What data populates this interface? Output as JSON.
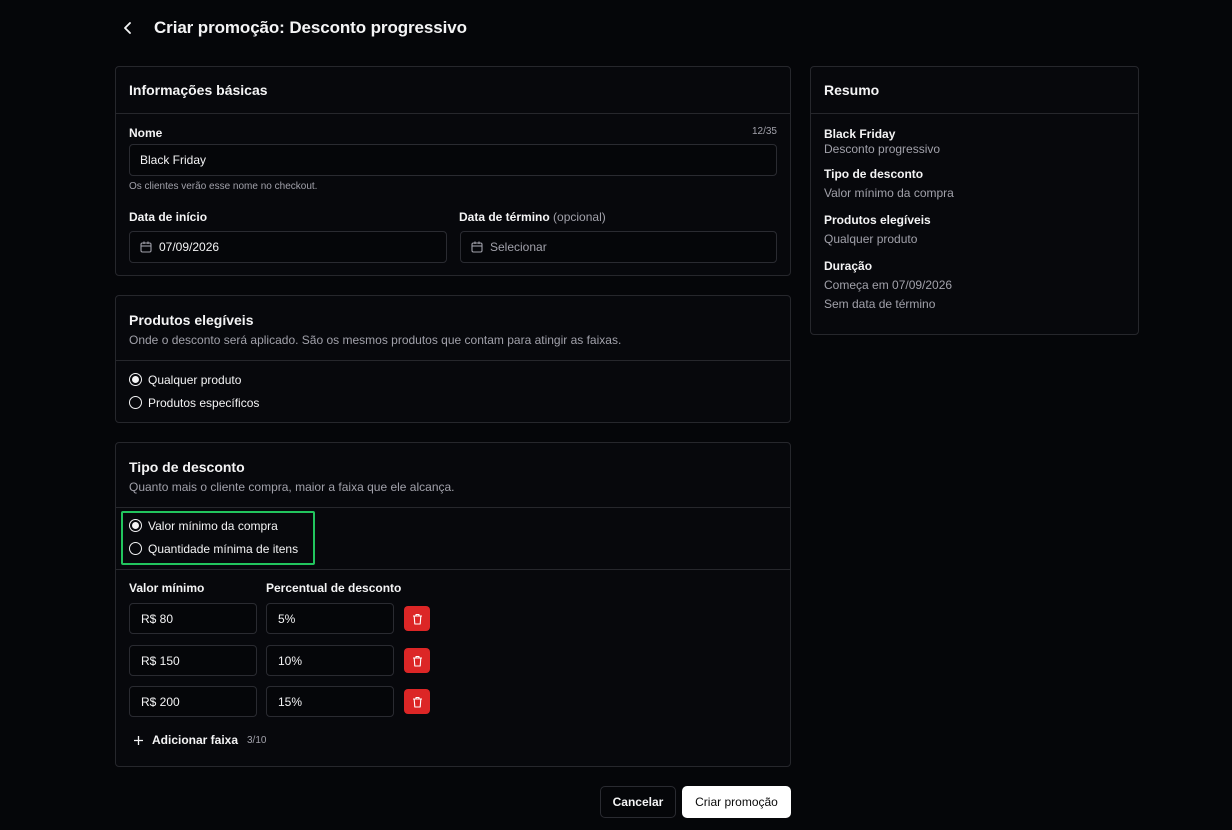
{
  "header": {
    "title": "Criar promoção: Desconto progressivo"
  },
  "basic_info": {
    "title": "Informações básicas",
    "name_label": "Nome",
    "name_count": "12/35",
    "name_value": "Black Friday",
    "name_help": "Os clientes verão esse nome no checkout.",
    "start_label": "Data de início",
    "start_value": "07/09/2026",
    "end_label": "Data de término",
    "end_optional": "(opcional)",
    "end_placeholder": "Selecionar"
  },
  "products": {
    "title": "Produtos elegíveis",
    "description": "Onde o desconto será aplicado. São os mesmos produtos que contam para atingir as faixas.",
    "options": [
      "Qualquer produto",
      "Produtos específicos"
    ],
    "selected": 0
  },
  "discount_type": {
    "title": "Tipo de desconto",
    "description": "Quanto mais o cliente compra, maior a faixa que ele alcança.",
    "options": [
      "Valor mínimo da compra",
      "Quantidade mínima de itens"
    ],
    "selected": 0,
    "highlight_color": "#22c55e",
    "col_min": "Valor mínimo",
    "col_pct": "Percentual de desconto",
    "tiers": [
      {
        "min": "R$ 80",
        "pct": "5%"
      },
      {
        "min": "R$ 150",
        "pct": "10%"
      },
      {
        "min": "R$ 200",
        "pct": "15%"
      }
    ],
    "add_label": "Adicionar faixa",
    "tier_count": "3/10",
    "delete_color": "#dc2626"
  },
  "actions": {
    "cancel": "Cancelar",
    "create": "Criar promoção"
  },
  "summary": {
    "title": "Resumo",
    "name": "Black Friday",
    "name_sub": "Desconto progressivo",
    "type_title": "Tipo de desconto",
    "type_value": "Valor mínimo da compra",
    "products_title": "Produtos elegíveis",
    "products_value": "Qualquer produto",
    "duration_title": "Duração",
    "duration_start": "Começa em 07/09/2026",
    "duration_end": "Sem data de término"
  }
}
